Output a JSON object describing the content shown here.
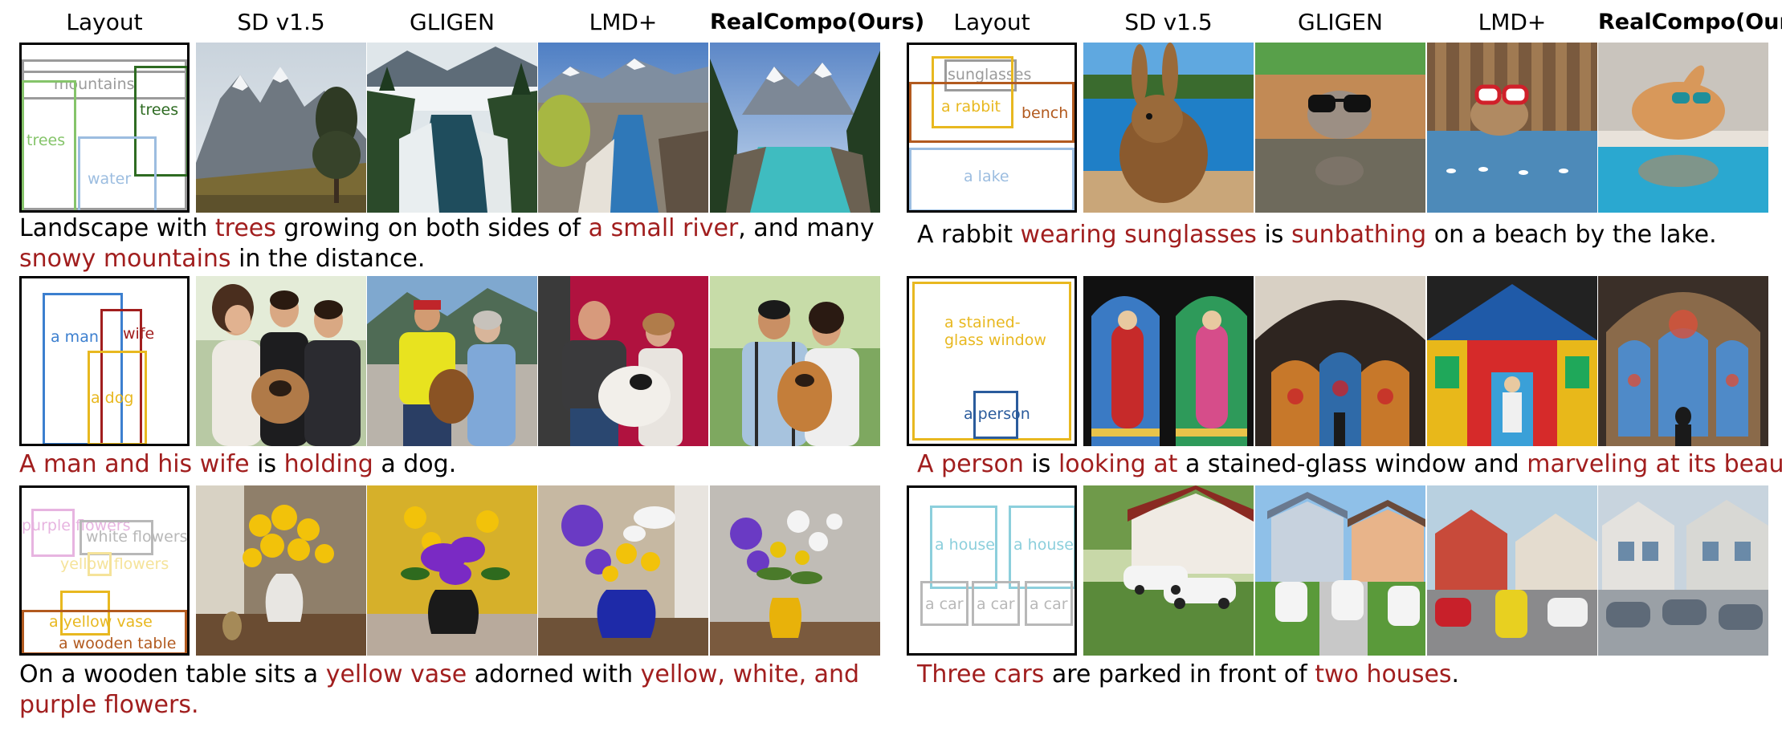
{
  "columns": [
    "Layout",
    "SD v1.5",
    "GLIGEN",
    "LMD+",
    "RealCompo(Ours)"
  ],
  "examples": [
    {
      "id": "landscape",
      "layout": {
        "boxes": [
          {
            "label": "mountains",
            "color": "#9b9b9b"
          },
          {
            "label": "trees",
            "color": "#2e6b22"
          },
          {
            "label": "trees",
            "color": "#85c46a"
          },
          {
            "label": "water",
            "color": "#9cbde0"
          }
        ]
      },
      "caption": [
        {
          "text": "Landscape with ",
          "hl": false
        },
        {
          "text": "trees",
          "hl": true
        },
        {
          "text": " growing on both sides of ",
          "hl": false
        },
        {
          "text": "a small river",
          "hl": true
        },
        {
          "text": ", and many ",
          "hl": false
        },
        {
          "text": "snowy mountains",
          "hl": true
        },
        {
          "text": " in the distance.",
          "hl": false
        }
      ]
    },
    {
      "id": "rabbit",
      "layout": {
        "boxes": [
          {
            "label": "sunglasses",
            "color": "#9b9b9b"
          },
          {
            "label": "a rabbit",
            "color": "#e8b820"
          },
          {
            "label": "bench",
            "color": "#b25a1f"
          },
          {
            "label": "a lake",
            "color": "#9cbde0"
          }
        ]
      },
      "caption": [
        {
          "text": "A rabbit ",
          "hl": false
        },
        {
          "text": "wearing sunglasses",
          "hl": true
        },
        {
          "text": " is ",
          "hl": false
        },
        {
          "text": "sunbathing",
          "hl": true
        },
        {
          "text": " on a beach by the lake.",
          "hl": false
        }
      ]
    },
    {
      "id": "man-wife-dog",
      "layout": {
        "boxes": [
          {
            "label": "a man",
            "color": "#3c7fcf"
          },
          {
            "label": "wife",
            "color": "#a11e1e"
          },
          {
            "label": "a dog",
            "color": "#e8b820"
          }
        ]
      },
      "caption": [
        {
          "text": "A man and his wife",
          "hl": true
        },
        {
          "text": " is ",
          "hl": false
        },
        {
          "text": "holding",
          "hl": true
        },
        {
          "text": " a dog.",
          "hl": false
        }
      ]
    },
    {
      "id": "stained-glass",
      "layout": {
        "boxes": [
          {
            "label": "a stained-glass window",
            "color": "#e8b820"
          },
          {
            "label": "a person",
            "color": "#2a5b9c"
          }
        ]
      },
      "caption": [
        {
          "text": "A person",
          "hl": true
        },
        {
          "text": " is ",
          "hl": false
        },
        {
          "text": "looking at",
          "hl": true
        },
        {
          "text": " a stained-glass window and ",
          "hl": false
        },
        {
          "text": "marveling at its beauty",
          "hl": true
        },
        {
          "text": ".",
          "hl": false
        }
      ]
    },
    {
      "id": "vase",
      "layout": {
        "boxes": [
          {
            "label": "purple flowers",
            "color": "#e7b4e0"
          },
          {
            "label": "white flowers",
            "color": "#b8b8b8"
          },
          {
            "label": "yellow flowers",
            "color": "#f5e39a"
          },
          {
            "label": "a yellow vase",
            "color": "#e8b820"
          },
          {
            "label": "a wooden table",
            "color": "#b25a1f"
          }
        ]
      },
      "caption": [
        {
          "text": "On a wooden table sits a ",
          "hl": false
        },
        {
          "text": "yellow vase",
          "hl": true
        },
        {
          "text": " adorned with ",
          "hl": false
        },
        {
          "text": "yellow, white, and purple flowers",
          "hl": true
        },
        {
          "text": ".",
          "hl": false
        }
      ]
    },
    {
      "id": "houses-cars",
      "layout": {
        "boxes": [
          {
            "label": "a house",
            "color": "#8ccfdc"
          },
          {
            "label": "a house",
            "color": "#8ccfdc"
          },
          {
            "label": "a car",
            "color": "#b8b8b8"
          },
          {
            "label": "a car",
            "color": "#b8b8b8"
          },
          {
            "label": "a car",
            "color": "#b8b8b8"
          }
        ]
      },
      "caption": [
        {
          "text": "Three cars",
          "hl": true
        },
        {
          "text": " are parked in front of ",
          "hl": false
        },
        {
          "text": "two houses",
          "hl": true
        },
        {
          "text": ".",
          "hl": false
        }
      ]
    }
  ]
}
